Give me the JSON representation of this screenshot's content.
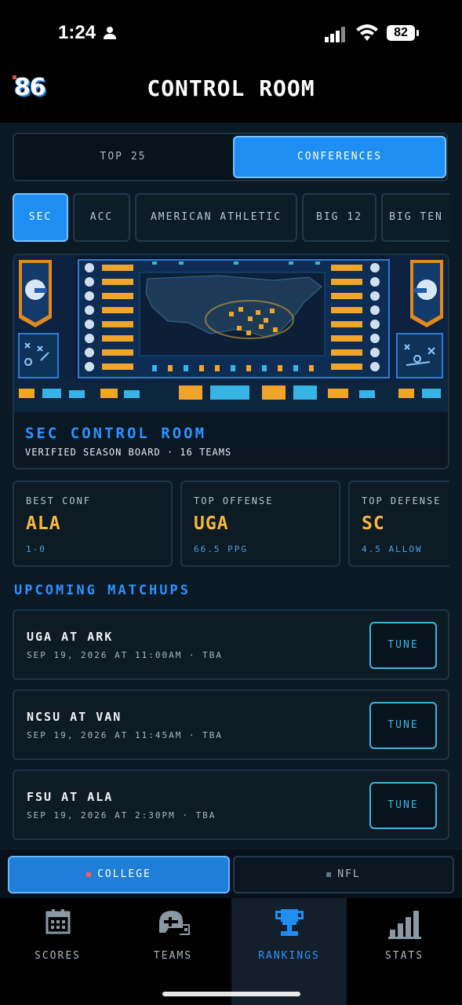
{
  "status_bar": {
    "time": "1:24",
    "battery": "82"
  },
  "header": {
    "logo": "86",
    "title": "CONTROL ROOM"
  },
  "segment": {
    "options": [
      "TOP 25",
      "CONFERENCES"
    ],
    "selected": "CONFERENCES"
  },
  "conference_chips": {
    "items": [
      "SEC",
      "ACC",
      "AMERICAN ATHLETIC",
      "BIG 12",
      "BIG TEN"
    ],
    "selected": "SEC"
  },
  "hero": {
    "title": "SEC CONTROL ROOM",
    "subtitle": "VERIFIED SEASON BOARD · 16 TEAMS"
  },
  "stats": [
    {
      "label": "BEST CONF",
      "value": "ALA",
      "sub": "1-0"
    },
    {
      "label": "TOP OFFENSE",
      "value": "UGA",
      "sub": "66.5 PPG"
    },
    {
      "label": "TOP DEFENSE",
      "value": "SC",
      "sub": "4.5 ALLOW"
    }
  ],
  "upcoming": {
    "title": "UPCOMING MATCHUPS",
    "tune_label": "TUNE",
    "games": [
      {
        "title": "UGA AT ARK",
        "sub": "SEP 19, 2026 AT 11:00AM · TBA"
      },
      {
        "title": "NCSU AT VAN",
        "sub": "SEP 19, 2026 AT 11:45AM · TBA"
      },
      {
        "title": "FSU AT ALA",
        "sub": "SEP 19, 2026 AT 2:30PM · TBA"
      }
    ]
  },
  "league_toggle": {
    "college": "COLLEGE",
    "nfl": "NFL",
    "selected": "COLLEGE"
  },
  "tabs": [
    {
      "label": "SCORES",
      "icon": "calendar-icon"
    },
    {
      "label": "TEAMS",
      "icon": "helmet-icon"
    },
    {
      "label": "RANKINGS",
      "icon": "trophy-icon"
    },
    {
      "label": "STATS",
      "icon": "bar-chart-icon"
    }
  ],
  "active_tab": "RANKINGS",
  "colors": {
    "accent": "#1f8ef2",
    "gold": "#f5b83c",
    "cyan": "#37b4e6",
    "bg": "#0b1a24"
  }
}
